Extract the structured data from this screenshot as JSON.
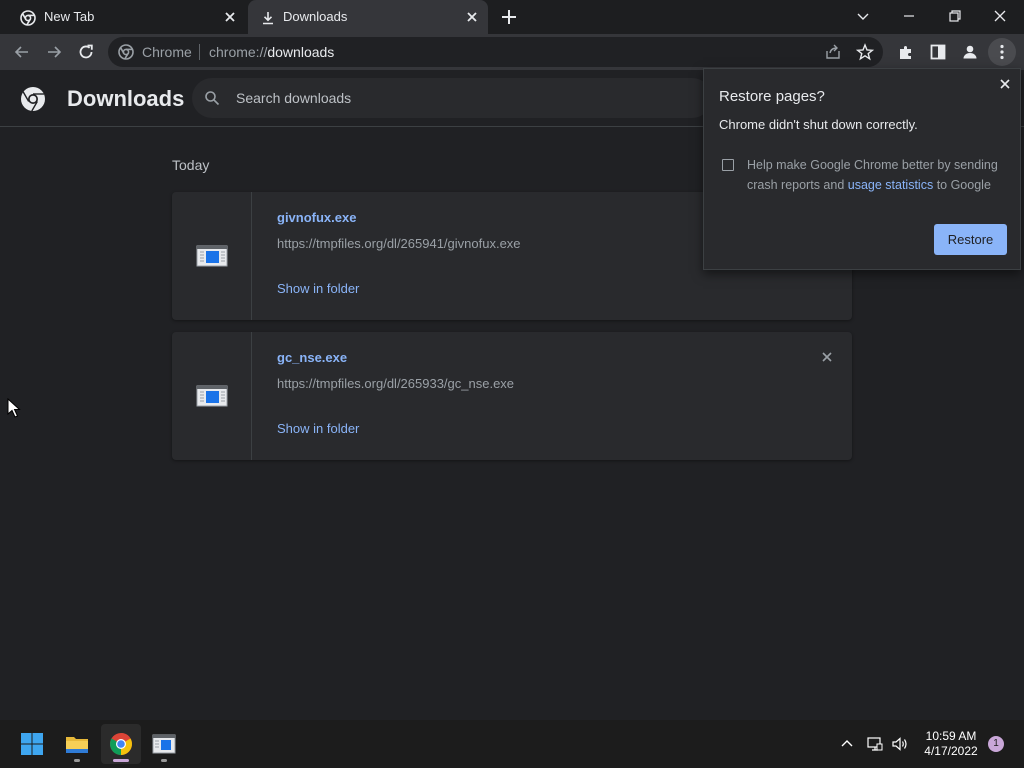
{
  "tabs": [
    {
      "label": "New Tab",
      "icon": "chrome-icon"
    },
    {
      "label": "Downloads",
      "icon": "download-icon"
    }
  ],
  "omnibox": {
    "chip": "Chrome",
    "scheme": "chrome://",
    "host": "downloads"
  },
  "page": {
    "title": "Downloads",
    "search_placeholder": "Search downloads",
    "date_label": "Today"
  },
  "downloads": [
    {
      "name": "givnofux.exe",
      "url": "https://tmpfiles.org/dl/265941/givnofux.exe",
      "action": "Show in folder"
    },
    {
      "name": "gc_nse.exe",
      "url": "https://tmpfiles.org/dl/265933/gc_nse.exe",
      "action": "Show in folder"
    }
  ],
  "popup": {
    "title": "Restore pages?",
    "message": "Chrome didn't shut down correctly.",
    "consent_pre": "Help make Google Chrome better by sending crash reports and ",
    "consent_link": "usage statistics",
    "consent_post": " to Google",
    "checkbox_checked": false,
    "button": "Restore"
  },
  "taskbar": {
    "apps": [
      "windows-start-icon",
      "file-explorer-icon",
      "chrome-icon",
      "app-window-icon"
    ],
    "time": "10:59 AM",
    "date": "4/17/2022",
    "notification_count": "1"
  },
  "colors": {
    "accent": "#8ab4f8",
    "background": "#202124",
    "card": "#292a2d",
    "toolbar": "#35363a"
  }
}
